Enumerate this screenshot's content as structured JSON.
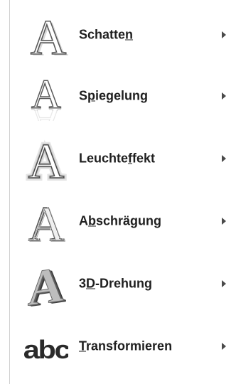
{
  "menu": {
    "items": [
      {
        "label": "Schatten",
        "icon": "shadow-effect-icon",
        "accelerator": "n"
      },
      {
        "label": "Spiegelung",
        "icon": "reflection-effect-icon",
        "accelerator": "p"
      },
      {
        "label": "Leuchteffekt",
        "icon": "glow-effect-icon",
        "accelerator": "f"
      },
      {
        "label": "Abschrägung",
        "icon": "bevel-effect-icon",
        "accelerator": "b"
      },
      {
        "label": "3D-Drehung",
        "icon": "3d-rotation-effect-icon",
        "accelerator": "D"
      },
      {
        "label": "Transformieren",
        "icon": "transform-effect-icon",
        "accelerator": "T"
      }
    ],
    "icon_glyph": "A",
    "transform_glyph": "abc"
  }
}
